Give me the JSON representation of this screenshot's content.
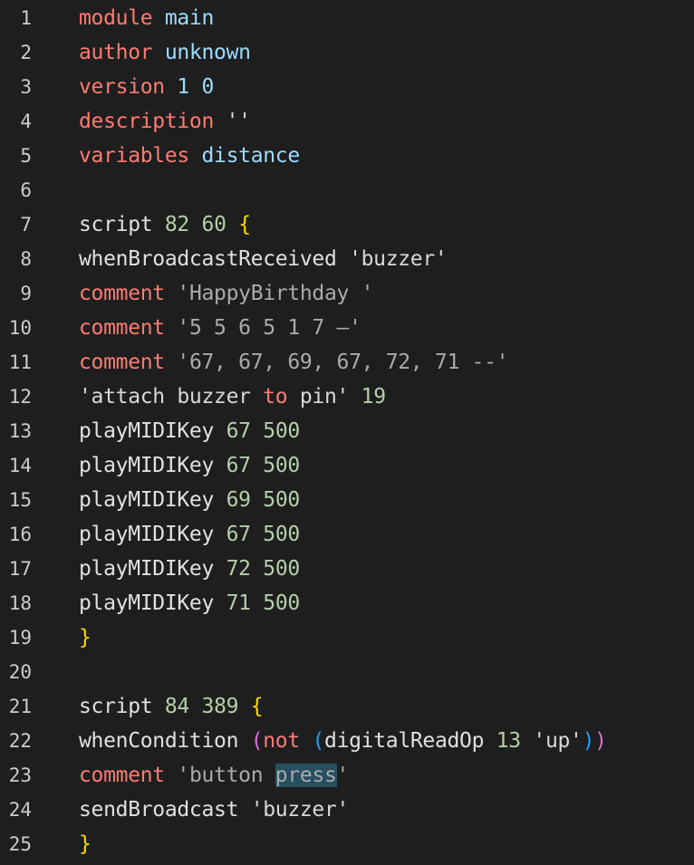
{
  "editor": {
    "lines": [
      {
        "n": "1",
        "tokens": [
          {
            "t": "module",
            "c": "kw"
          },
          {
            "t": " ",
            "c": "plain"
          },
          {
            "t": "main",
            "c": "id"
          }
        ]
      },
      {
        "n": "2",
        "tokens": [
          {
            "t": "author",
            "c": "kw"
          },
          {
            "t": " ",
            "c": "plain"
          },
          {
            "t": "unknown",
            "c": "id"
          }
        ]
      },
      {
        "n": "3",
        "tokens": [
          {
            "t": "version",
            "c": "kw"
          },
          {
            "t": " ",
            "c": "plain"
          },
          {
            "t": "1",
            "c": "id"
          },
          {
            "t": " ",
            "c": "plain"
          },
          {
            "t": "0",
            "c": "id"
          }
        ]
      },
      {
        "n": "4",
        "tokens": [
          {
            "t": "description",
            "c": "kw"
          },
          {
            "t": " ",
            "c": "plain"
          },
          {
            "t": "''",
            "c": "str"
          }
        ]
      },
      {
        "n": "5",
        "tokens": [
          {
            "t": "variables",
            "c": "kw"
          },
          {
            "t": " ",
            "c": "plain"
          },
          {
            "t": "distance",
            "c": "id"
          }
        ]
      },
      {
        "n": "6",
        "tokens": []
      },
      {
        "n": "7",
        "tokens": [
          {
            "t": "script",
            "c": "plain"
          },
          {
            "t": " ",
            "c": "plain"
          },
          {
            "t": "82",
            "c": "num"
          },
          {
            "t": " ",
            "c": "plain"
          },
          {
            "t": "60",
            "c": "num"
          },
          {
            "t": " ",
            "c": "plain"
          },
          {
            "t": "{",
            "c": "brace"
          }
        ]
      },
      {
        "n": "8",
        "tokens": [
          {
            "t": "whenBroadcastReceived",
            "c": "plain"
          },
          {
            "t": " ",
            "c": "plain"
          },
          {
            "t": "'buzzer'",
            "c": "str"
          }
        ]
      },
      {
        "n": "9",
        "tokens": [
          {
            "t": "comment",
            "c": "kw"
          },
          {
            "t": " ",
            "c": "plain"
          },
          {
            "t": "'HappyBirthday '",
            "c": "cmt"
          }
        ]
      },
      {
        "n": "10",
        "tokens": [
          {
            "t": "comment",
            "c": "kw"
          },
          {
            "t": " ",
            "c": "plain"
          },
          {
            "t": "'5 5 6 5 1 7 —'",
            "c": "cmt"
          }
        ]
      },
      {
        "n": "11",
        "tokens": [
          {
            "t": "comment",
            "c": "kw"
          },
          {
            "t": " ",
            "c": "plain"
          },
          {
            "t": "'67, 67, 69, 67, 72, 71 --'",
            "c": "cmt"
          }
        ]
      },
      {
        "n": "12",
        "tokens": [
          {
            "t": "'attach buzzer ",
            "c": "str"
          },
          {
            "t": "to",
            "c": "kw"
          },
          {
            "t": " pin'",
            "c": "str"
          },
          {
            "t": " ",
            "c": "plain"
          },
          {
            "t": "19",
            "c": "num"
          }
        ]
      },
      {
        "n": "13",
        "tokens": [
          {
            "t": "playMIDIKey",
            "c": "plain"
          },
          {
            "t": " ",
            "c": "plain"
          },
          {
            "t": "67",
            "c": "num"
          },
          {
            "t": " ",
            "c": "plain"
          },
          {
            "t": "500",
            "c": "num"
          }
        ]
      },
      {
        "n": "14",
        "tokens": [
          {
            "t": "playMIDIKey",
            "c": "plain"
          },
          {
            "t": " ",
            "c": "plain"
          },
          {
            "t": "67",
            "c": "num"
          },
          {
            "t": " ",
            "c": "plain"
          },
          {
            "t": "500",
            "c": "num"
          }
        ]
      },
      {
        "n": "15",
        "tokens": [
          {
            "t": "playMIDIKey",
            "c": "plain"
          },
          {
            "t": " ",
            "c": "plain"
          },
          {
            "t": "69",
            "c": "num"
          },
          {
            "t": " ",
            "c": "plain"
          },
          {
            "t": "500",
            "c": "num"
          }
        ]
      },
      {
        "n": "16",
        "tokens": [
          {
            "t": "playMIDIKey",
            "c": "plain"
          },
          {
            "t": " ",
            "c": "plain"
          },
          {
            "t": "67",
            "c": "num"
          },
          {
            "t": " ",
            "c": "plain"
          },
          {
            "t": "500",
            "c": "num"
          }
        ]
      },
      {
        "n": "17",
        "tokens": [
          {
            "t": "playMIDIKey",
            "c": "plain"
          },
          {
            "t": " ",
            "c": "plain"
          },
          {
            "t": "72",
            "c": "num"
          },
          {
            "t": " ",
            "c": "plain"
          },
          {
            "t": "500",
            "c": "num"
          }
        ]
      },
      {
        "n": "18",
        "tokens": [
          {
            "t": "playMIDIKey",
            "c": "plain"
          },
          {
            "t": " ",
            "c": "plain"
          },
          {
            "t": "71",
            "c": "num"
          },
          {
            "t": " ",
            "c": "plain"
          },
          {
            "t": "500",
            "c": "num"
          }
        ]
      },
      {
        "n": "19",
        "tokens": [
          {
            "t": "}",
            "c": "brace"
          }
        ]
      },
      {
        "n": "20",
        "tokens": []
      },
      {
        "n": "21",
        "tokens": [
          {
            "t": "script",
            "c": "plain"
          },
          {
            "t": " ",
            "c": "plain"
          },
          {
            "t": "84",
            "c": "num"
          },
          {
            "t": " ",
            "c": "plain"
          },
          {
            "t": "389",
            "c": "num"
          },
          {
            "t": " ",
            "c": "plain"
          },
          {
            "t": "{",
            "c": "brace"
          }
        ]
      },
      {
        "n": "22",
        "tokens": [
          {
            "t": "whenCondition",
            "c": "plain"
          },
          {
            "t": " ",
            "c": "plain"
          },
          {
            "t": "(",
            "c": "paren1"
          },
          {
            "t": "not",
            "c": "kw"
          },
          {
            "t": " ",
            "c": "plain"
          },
          {
            "t": "(",
            "c": "paren2"
          },
          {
            "t": "digitalReadOp",
            "c": "plain"
          },
          {
            "t": " ",
            "c": "plain"
          },
          {
            "t": "13",
            "c": "num"
          },
          {
            "t": " ",
            "c": "plain"
          },
          {
            "t": "'up'",
            "c": "str"
          },
          {
            "t": ")",
            "c": "paren2"
          },
          {
            "t": ")",
            "c": "paren1"
          }
        ]
      },
      {
        "n": "23",
        "tokens": [
          {
            "t": "comment",
            "c": "kw"
          },
          {
            "t": " ",
            "c": "plain"
          },
          {
            "t": "'button ",
            "c": "cmt"
          },
          {
            "t": "press",
            "c": "hl"
          },
          {
            "t": "'",
            "c": "cmt"
          }
        ]
      },
      {
        "n": "24",
        "tokens": [
          {
            "t": "sendBroadcast",
            "c": "plain"
          },
          {
            "t": " ",
            "c": "plain"
          },
          {
            "t": "'buzzer'",
            "c": "str"
          }
        ]
      },
      {
        "n": "25",
        "tokens": [
          {
            "t": "}",
            "c": "brace"
          }
        ]
      }
    ]
  }
}
